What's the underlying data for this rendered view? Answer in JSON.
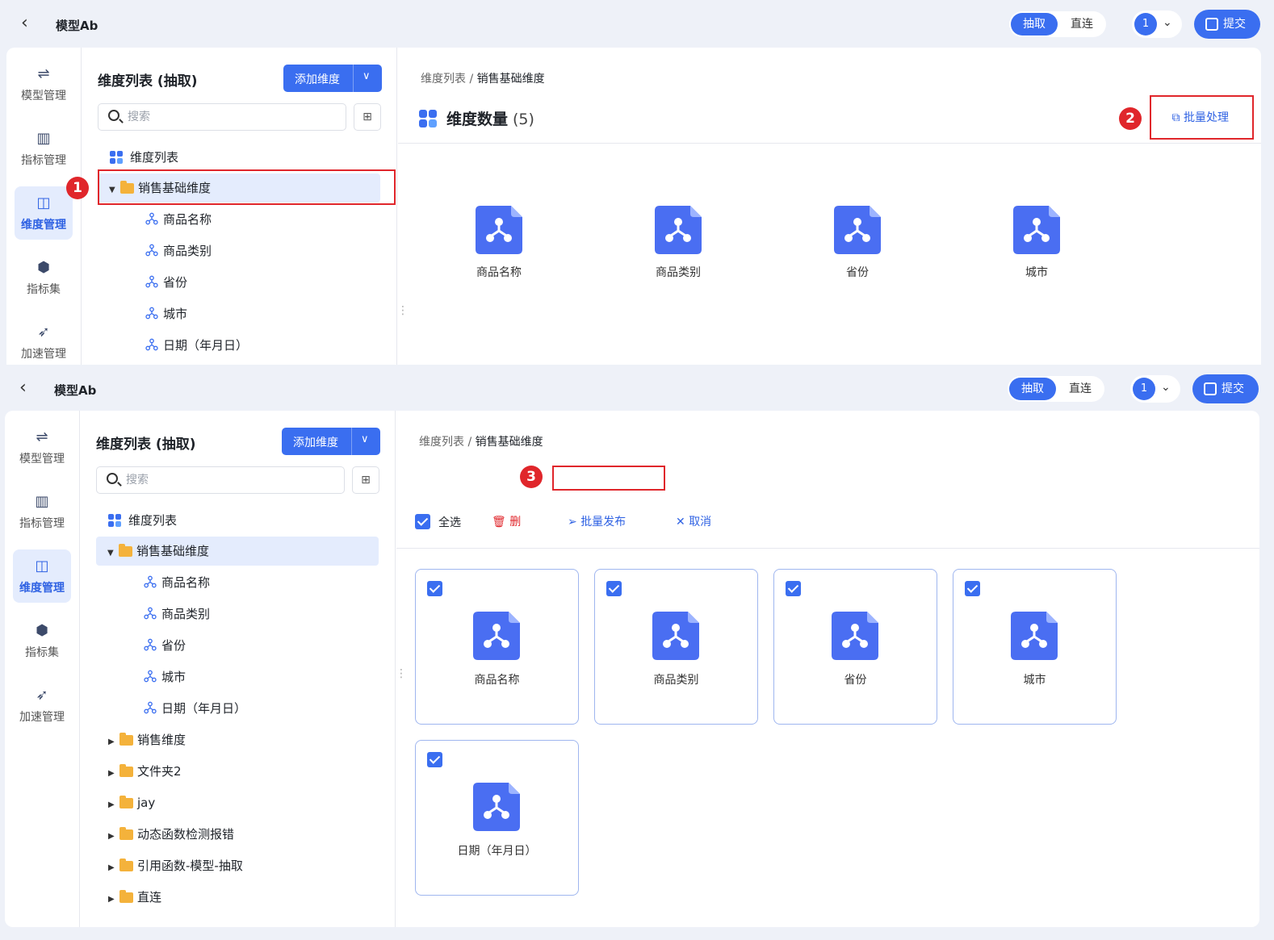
{
  "app": {
    "title": "模型Ab",
    "mode_active": "抽取",
    "mode_other": "直连",
    "version": "1",
    "submit_label": "提交"
  },
  "nav": [
    {
      "label": "模型管理",
      "icon": "model-icon"
    },
    {
      "label": "指标管理",
      "icon": "metric-icon"
    },
    {
      "label": "维度管理",
      "icon": "dimension-icon",
      "active": true
    },
    {
      "label": "指标集",
      "icon": "cube-icon"
    },
    {
      "label": "加速管理",
      "icon": "rocket-icon"
    }
  ],
  "tree": {
    "title": "维度列表 (抽取)",
    "add_label": "添加维度",
    "search_placeholder": "搜索",
    "root": "维度列表",
    "selected_folder": "销售基础维度",
    "children": [
      "商品名称",
      "商品类别",
      "省份",
      "城市",
      "日期（年月日）"
    ],
    "folders": [
      "销售维度",
      "文件夹2",
      "jay",
      "动态函数检测报错",
      "引用函数-模型-抽取",
      "直连"
    ]
  },
  "main": {
    "crumb_root": "维度列表",
    "crumb_sep": "/",
    "crumb_current": "销售基础维度",
    "count_title": "维度数量",
    "count_value": "(5)",
    "batch_label": "批量处理",
    "select_all": "全选",
    "delete_label": "删",
    "publish_label": "批量发布",
    "cancel_label": "取消",
    "items": [
      "商品名称",
      "商品类别",
      "省份",
      "城市",
      "日期（年月日）"
    ]
  },
  "annotations": [
    "1",
    "2",
    "3"
  ],
  "colors": {
    "primary": "#3a6ef0",
    "highlight": "#e0262b",
    "folder": "#f4b23b"
  }
}
